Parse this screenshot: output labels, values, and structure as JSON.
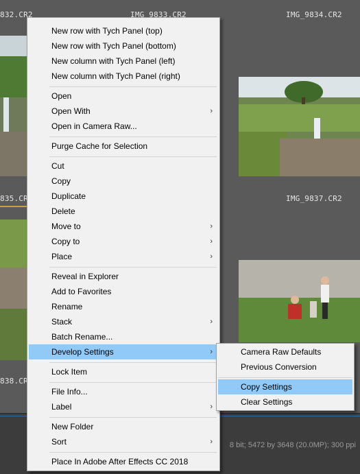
{
  "thumbnails": {
    "names": [
      "832.CR2",
      "IMG_9833.CR2",
      "IMG_9834.CR2",
      "835.CR2",
      "IMG_9837.CR2",
      "838.CR2"
    ]
  },
  "status_bar": {
    "info": "8 bit; 5472 by 3648 (20.0MP); 300 ppi"
  },
  "context_menu": {
    "items": [
      {
        "label": "New row with Tych Panel (top)"
      },
      {
        "label": "New row with Tych Panel (bottom)"
      },
      {
        "label": "New column with Tych Panel (left)"
      },
      {
        "label": "New column with Tych Panel (right)"
      },
      {
        "label": "Open"
      },
      {
        "label": "Open With"
      },
      {
        "label": "Open in Camera Raw..."
      },
      {
        "label": "Purge Cache for Selection"
      },
      {
        "label": "Cut"
      },
      {
        "label": "Copy"
      },
      {
        "label": "Duplicate"
      },
      {
        "label": "Delete"
      },
      {
        "label": "Move to"
      },
      {
        "label": "Copy to"
      },
      {
        "label": "Place"
      },
      {
        "label": "Reveal in Explorer"
      },
      {
        "label": "Add to Favorites"
      },
      {
        "label": "Rename"
      },
      {
        "label": "Stack"
      },
      {
        "label": "Batch Rename..."
      },
      {
        "label": "Develop Settings"
      },
      {
        "label": "Lock Item"
      },
      {
        "label": "File Info..."
      },
      {
        "label": "Label"
      },
      {
        "label": "New Folder"
      },
      {
        "label": "Sort"
      },
      {
        "label": "Place In Adobe After Effects CC 2018"
      }
    ],
    "submenu_arrow": "›"
  },
  "develop_submenu": {
    "items": [
      {
        "label": "Camera Raw Defaults"
      },
      {
        "label": "Previous Conversion"
      },
      {
        "label": "Copy Settings"
      },
      {
        "label": "Clear Settings"
      }
    ]
  },
  "colors": {
    "highlight": "#91c9f7",
    "menu_bg": "#f1f1f1",
    "panel_bg": "#5a5a5a",
    "selection_border": "#c8a04a"
  }
}
